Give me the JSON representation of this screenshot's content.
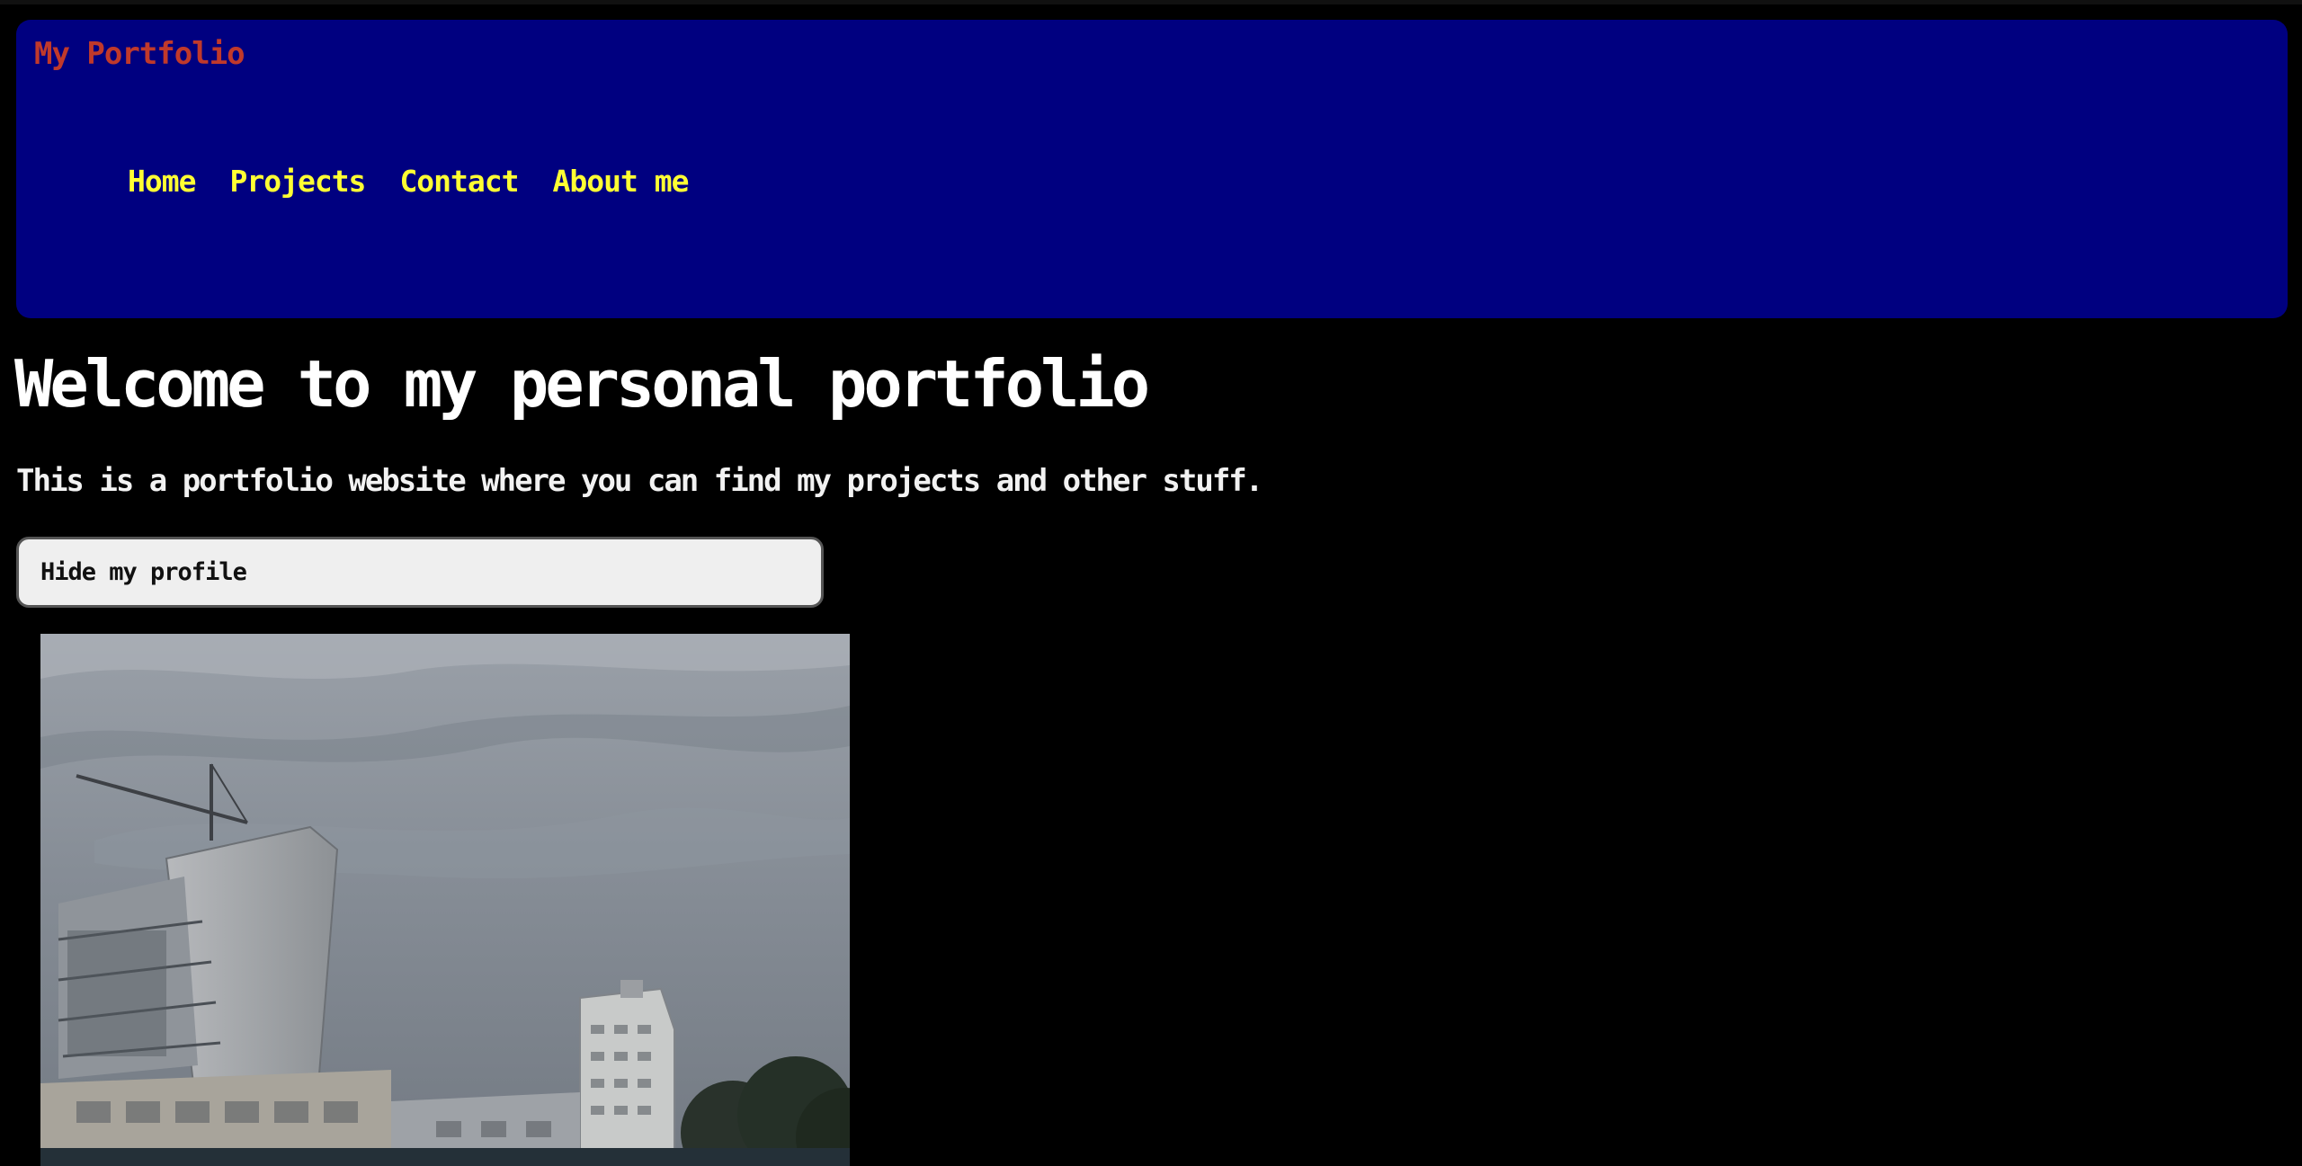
{
  "header": {
    "brand": "My Portfolio",
    "nav": [
      "Home",
      "Projects",
      "Contact",
      "About me"
    ]
  },
  "main": {
    "title": "Welcome to my personal portfolio",
    "intro": "This is a portfolio website where you can find my projects and other stuff.",
    "toggle_label": "Hide my profile"
  },
  "colors": {
    "page_background": "#000000",
    "header_background": "#000080",
    "brand": "#c0392b",
    "nav_link": "#ffff33",
    "heading": "#ffffff"
  },
  "icons": {
    "profile_photo": "city-skyline-photo"
  }
}
